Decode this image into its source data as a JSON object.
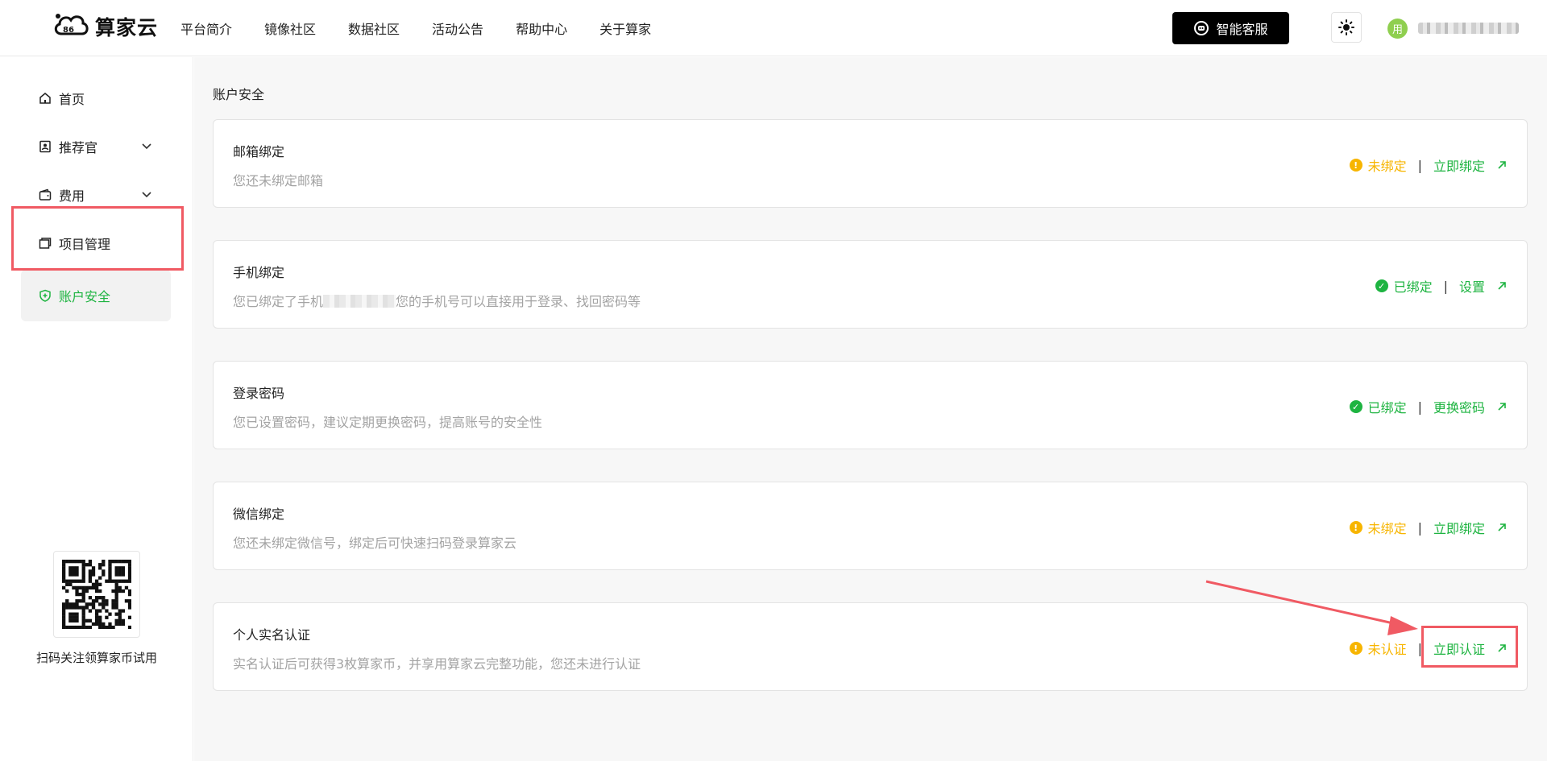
{
  "header": {
    "brand": "算家云",
    "nav": [
      "平台简介",
      "镜像社区",
      "数据社区",
      "活动公告",
      "帮助中心",
      "关于算家"
    ],
    "service_button": "智能客服",
    "avatar_text": "用"
  },
  "sidebar": {
    "items": [
      {
        "label": "首页",
        "icon": "home-icon"
      },
      {
        "label": "推荐官",
        "icon": "badge-icon"
      },
      {
        "label": "费用",
        "icon": "wallet-icon"
      },
      {
        "label": "项目管理",
        "icon": "folder-icon"
      },
      {
        "label": "账户安全",
        "icon": "shield-icon"
      }
    ],
    "qr_caption": "扫码关注领算家币试用"
  },
  "main": {
    "title": "账户安全",
    "cards": [
      {
        "title": "邮箱绑定",
        "desc": "您还未绑定邮箱",
        "status": "未绑定",
        "state": "warn",
        "action": "立即绑定"
      },
      {
        "title": "手机绑定",
        "desc_before": "您已绑定了手机",
        "desc_after": "您的手机号可以直接用于登录、找回密码等",
        "status": "已绑定",
        "state": "ok",
        "action": "设置"
      },
      {
        "title": "登录密码",
        "desc": "您已设置密码，建议定期更换密码，提高账号的安全性",
        "status": "已绑定",
        "state": "ok",
        "action": "更换密码"
      },
      {
        "title": "微信绑定",
        "desc": "您还未绑定微信号，绑定后可快速扫码登录算家云",
        "status": "未绑定",
        "state": "warn",
        "action": "立即绑定"
      },
      {
        "title": "个人实名认证",
        "desc": "实名认证后可获得3枚算家币，并享用算家云完整功能，您还未进行认证",
        "status": "未认证",
        "state": "warn",
        "action": "立即认证"
      }
    ]
  },
  "colors": {
    "accent_green": "#1eb441",
    "warning": "#f7b500",
    "highlight_red": "#f05a63"
  }
}
